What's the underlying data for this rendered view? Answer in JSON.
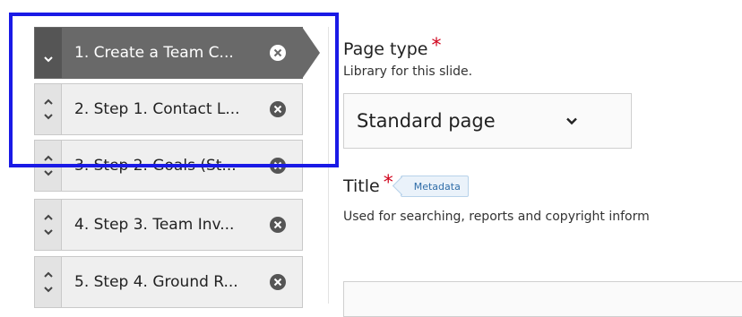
{
  "steps": [
    {
      "label": "1. Create a Team C...",
      "active": true
    },
    {
      "label": "2. Step 1. Contact L..."
    },
    {
      "label": "3. Step 2. Goals (St..."
    },
    {
      "label": "4. Step 3. Team Inv..."
    },
    {
      "label": "5. Step 4. Ground R..."
    }
  ],
  "form": {
    "page_type": {
      "title": "Page type",
      "required_mark": "*",
      "help": "Library for this slide.",
      "selected": "Standard page"
    },
    "title_field": {
      "title": "Title",
      "required_mark": "*",
      "badge": "Metadata",
      "help": "Used for searching, reports and copyright inform"
    }
  },
  "colors": {
    "active_step_bg": "#696969",
    "highlight_border": "#1a1ae6",
    "required": "#d0021b"
  }
}
